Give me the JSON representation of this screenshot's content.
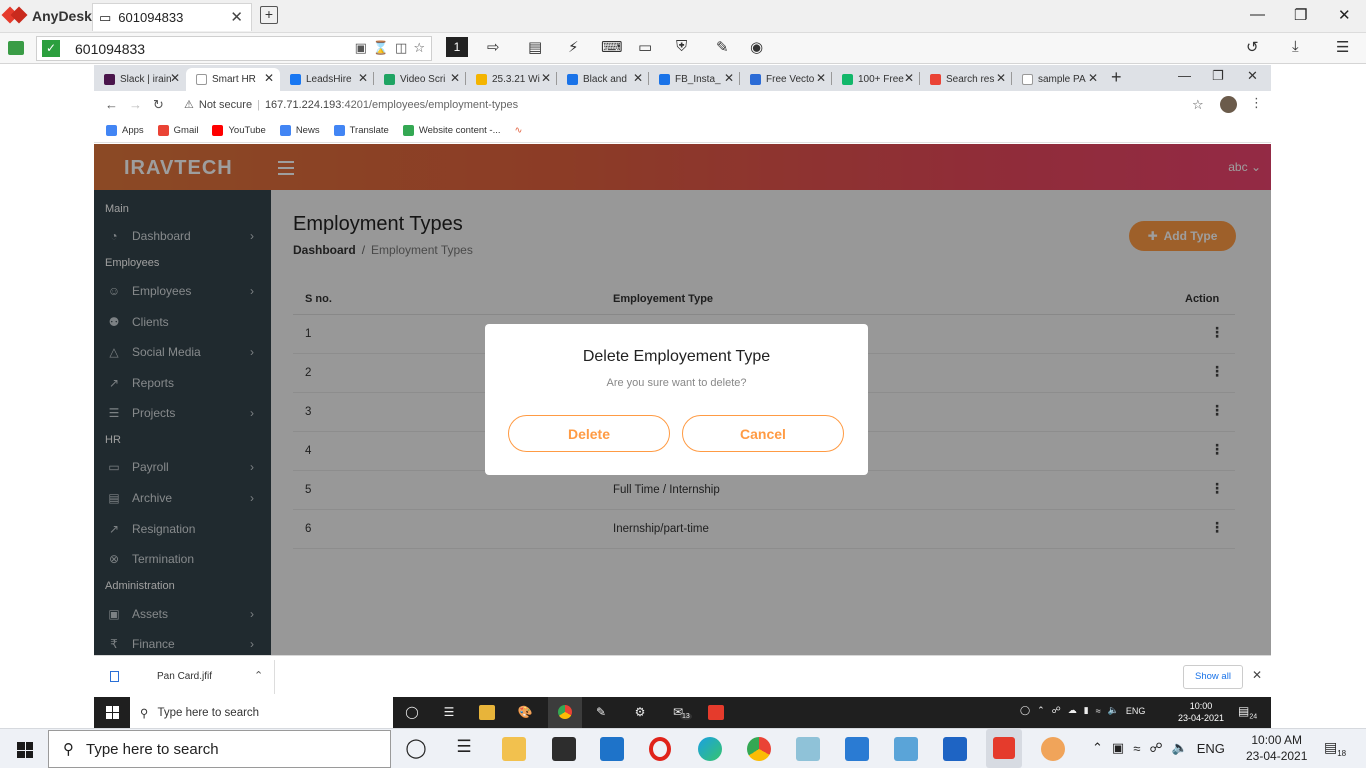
{
  "anydesk": {
    "app_name": "AnyDesk",
    "session_tab": "601094833",
    "address": "601094833",
    "monitor_number": "1"
  },
  "chrome": {
    "tabs": [
      {
        "label": "Slack | irain",
        "color": "#4a154b"
      },
      {
        "label": "Smart HR",
        "color": "#ffffff"
      },
      {
        "label": "LeadsHire",
        "color": "#1877f2"
      },
      {
        "label": "Video Scri",
        "color": "#1fa463"
      },
      {
        "label": "25.3.21 Wi",
        "color": "#f4b400"
      },
      {
        "label": "Black and",
        "color": "#1a73e8"
      },
      {
        "label": "FB_Insta_",
        "color": "#1a73e8"
      },
      {
        "label": "Free Vecto",
        "color": "#2b6bd6"
      },
      {
        "label": "100+ Free",
        "color": "#12b76a"
      },
      {
        "label": "Search res",
        "color": "#ea4335"
      },
      {
        "label": "sample PA",
        "color": "#ffffff"
      }
    ],
    "not_secure": "Not secure",
    "url_host": "167.71.224.193",
    "url_path": ":4201/employees/employment-types",
    "bookmarks": [
      {
        "label": "Apps",
        "color": "#4285f4"
      },
      {
        "label": "Gmail",
        "color": "#ea4335"
      },
      {
        "label": "YouTube",
        "color": "#ff0000"
      },
      {
        "label": "News",
        "color": "#4285f4"
      },
      {
        "label": "Translate",
        "color": "#4285f4"
      },
      {
        "label": "Website content -...",
        "color": "#34a853"
      }
    ]
  },
  "app": {
    "logo": "IRAVTECH",
    "user": "abc",
    "sidebar": {
      "sections": [
        "Main",
        "Employees",
        "HR",
        "Administration"
      ],
      "items": [
        {
          "label": "Dashboard",
          "icon": "dashboard-icon",
          "has_chevron": true
        },
        {
          "label": "Employees",
          "icon": "user-icon",
          "has_chevron": true
        },
        {
          "label": "Clients",
          "icon": "users-icon",
          "has_chevron": false
        },
        {
          "label": "Social Media",
          "icon": "social-icon",
          "has_chevron": true
        },
        {
          "label": "Reports",
          "icon": "chart-icon",
          "has_chevron": false
        },
        {
          "label": "Projects",
          "icon": "projects-icon",
          "has_chevron": true
        },
        {
          "label": "Payroll",
          "icon": "payroll-icon",
          "has_chevron": true
        },
        {
          "label": "Archive",
          "icon": "archive-icon",
          "has_chevron": true
        },
        {
          "label": "Resignation",
          "icon": "resignation-icon",
          "has_chevron": false
        },
        {
          "label": "Termination",
          "icon": "termination-icon",
          "has_chevron": false
        },
        {
          "label": "Assets",
          "icon": "assets-icon",
          "has_chevron": true
        },
        {
          "label": "Finance",
          "icon": "rupee-icon",
          "has_chevron": true
        }
      ]
    },
    "page": {
      "title": "Employment Types",
      "breadcrumb_home": "Dashboard",
      "breadcrumb_current": "Employment Types",
      "add_button": "Add Type"
    },
    "table": {
      "headers": [
        "S no.",
        "Employement Type",
        "Action"
      ],
      "rows": [
        {
          "sno": "1",
          "type": ""
        },
        {
          "sno": "2",
          "type": ""
        },
        {
          "sno": "3",
          "type": ""
        },
        {
          "sno": "4",
          "type": ""
        },
        {
          "sno": "5",
          "type": "Full Time / Internship"
        },
        {
          "sno": "6",
          "type": "Inernship/part-time"
        }
      ]
    },
    "modal": {
      "title": "Delete Employement Type",
      "message": "Are you sure want to delete?",
      "delete_label": "Delete",
      "cancel_label": "Cancel"
    }
  },
  "downloads": {
    "file": "Pan Card.jfif",
    "show_all": "Show all"
  },
  "remote_taskbar": {
    "search_placeholder": "Type here to search",
    "lang": "ENG",
    "time": "10:00",
    "date": "23-04-2021",
    "notifications": "24",
    "mail_badge": "13"
  },
  "local_taskbar": {
    "search_placeholder": "Type here to search",
    "lang": "ENG",
    "time": "10:00 AM",
    "date": "23-04-2021",
    "notifications": "18"
  },
  "colors": {
    "accent": "#ff9b44",
    "sidebar_bg": "#34444c",
    "header_start": "#e0773c",
    "header_end": "#ee4470"
  }
}
